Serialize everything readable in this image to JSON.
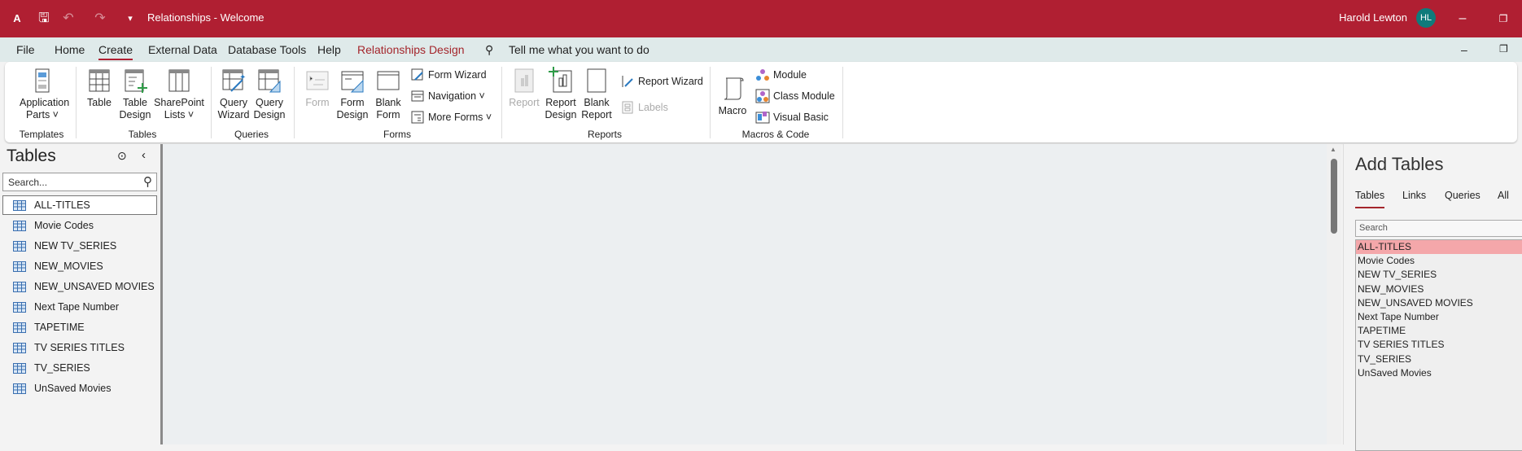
{
  "titlebar": {
    "title": "Relationships  -  Welcome",
    "user": "Harold Lewton",
    "initials": "HL"
  },
  "tabs": [
    "File",
    "Home",
    "Create",
    "External Data",
    "Database Tools",
    "Help",
    "Relationships Design"
  ],
  "tell_me": "Tell me what you want to do",
  "ribbon": {
    "templates": {
      "label": "Templates",
      "app_parts": "Application",
      "app_parts2": "Parts ˅"
    },
    "tables": {
      "label": "Tables",
      "table": "Table",
      "table_design1": "Table",
      "table_design2": "Design",
      "sharepoint1": "SharePoint",
      "sharepoint2": "Lists ˅"
    },
    "queries": {
      "label": "Queries",
      "wizard1": "Query",
      "wizard2": "Wizard",
      "design1": "Query",
      "design2": "Design"
    },
    "forms": {
      "label": "Forms",
      "form": "Form",
      "form_design1": "Form",
      "form_design2": "Design",
      "blank1": "Blank",
      "blank2": "Form",
      "wizard": "Form Wizard",
      "navigation": "Navigation ˅",
      "more": "More Forms ˅"
    },
    "reports": {
      "label": "Reports",
      "report": "Report",
      "design1": "Report",
      "design2": "Design",
      "blank1": "Blank",
      "blank2": "Report",
      "wizard": "Report Wizard",
      "labels": "Labels"
    },
    "macros": {
      "label": "Macros & Code",
      "macro": "Macro",
      "module": "Module",
      "class_module": "Class Module",
      "vb": "Visual Basic"
    }
  },
  "nav": {
    "title": "Tables",
    "search_placeholder": "Search...",
    "items": [
      "ALL-TITLES",
      "Movie Codes",
      "NEW TV_SERIES",
      "NEW_MOVIES",
      "NEW_UNSAVED MOVIES",
      "Next Tape Number",
      "TAPETIME",
      "TV SERIES TITLES",
      "TV_SERIES",
      "UnSaved Movies"
    ]
  },
  "add_tables": {
    "title": "Add Tables",
    "tabs": [
      "Tables",
      "Links",
      "Queries",
      "All"
    ],
    "search_placeholder": "Search",
    "items": [
      "ALL-TITLES",
      "Movie Codes",
      "NEW TV_SERIES",
      "NEW_MOVIES",
      "NEW_UNSAVED MOVIES",
      "Next Tape Number",
      "TAPETIME",
      "TV SERIES TITLES",
      "TV_SERIES",
      "UnSaved Movies"
    ]
  }
}
